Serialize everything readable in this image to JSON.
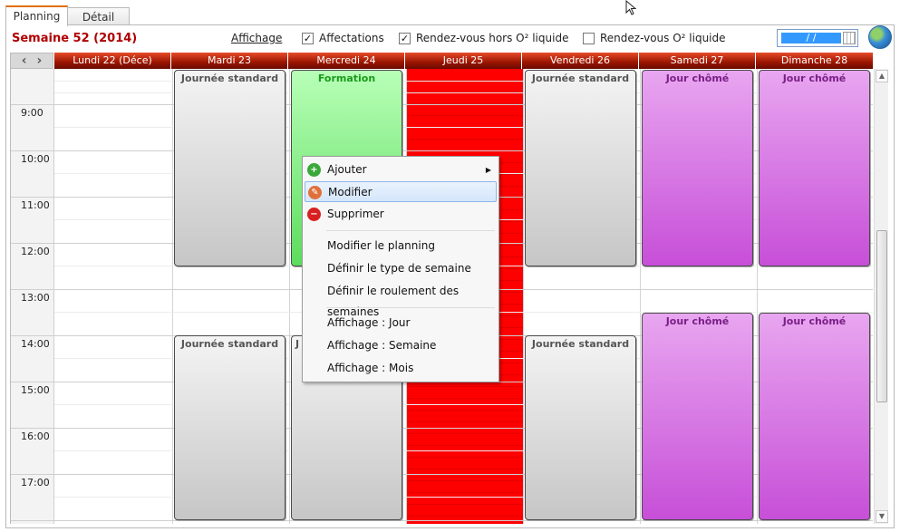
{
  "tabs": [
    {
      "label": "Planning",
      "active": true
    },
    {
      "label": "Détail",
      "active": false
    }
  ],
  "toolbar": {
    "week_title": "Semaine 52 (2014)",
    "affichage_label": "Affichage",
    "filters": [
      {
        "label": "Affectations",
        "checked": true
      },
      {
        "label": "Rendez-vous hors O² liquide",
        "checked": true
      },
      {
        "label": "Rendez-vous O² liquide",
        "checked": false
      }
    ],
    "date_value": "  /  /",
    "globe_icon": "globe-icon"
  },
  "nav": {
    "prev_icon": "chevron-left-icon",
    "next_icon": "chevron-right-icon",
    "prev_glyph": "‹",
    "next_glyph": "›"
  },
  "days": [
    "Lundi 22 (Déce)",
    "Mardi 23",
    "Mercredi 24",
    "Jeudi 25",
    "Vendredi 26",
    "Samedi 27",
    "Dimanche 28"
  ],
  "times": [
    "9:00",
    "10:00",
    "11:00",
    "12:00",
    "13:00",
    "14:00",
    "15:00",
    "16:00",
    "17:00"
  ],
  "events": [
    {
      "day": "Mardi 23",
      "label": "Journée standard",
      "kind": "standard",
      "period": "morning"
    },
    {
      "day": "Mercredi 24",
      "label": "Formation",
      "kind": "formation",
      "period": "morning"
    },
    {
      "day": "Jeudi 25",
      "label": "",
      "kind": "holiday-fill",
      "period": "all-day"
    },
    {
      "day": "Vendredi 26",
      "label": "Journée standard",
      "kind": "standard",
      "period": "morning"
    },
    {
      "day": "Samedi 27",
      "label": "Jour chômé",
      "kind": "chome",
      "period": "morning"
    },
    {
      "day": "Dimanche 28",
      "label": "Jour chômé",
      "kind": "chome",
      "period": "morning"
    },
    {
      "day": "Mardi 23",
      "label": "Journée standard",
      "kind": "standard",
      "period": "afternoon"
    },
    {
      "day": "Mercredi 24",
      "label": "J",
      "kind": "standard",
      "period": "afternoon"
    },
    {
      "day": "Vendredi 26",
      "label": "Journée standard",
      "kind": "standard",
      "period": "afternoon"
    },
    {
      "day": "Samedi 27",
      "label": "Jour chômé",
      "kind": "chome",
      "period": "afternoon"
    },
    {
      "day": "Dimanche 28",
      "label": "Jour chômé",
      "kind": "chome",
      "period": "afternoon"
    }
  ],
  "context_menu": {
    "items": [
      {
        "label": "Ajouter",
        "icon": "add-icon",
        "submenu": true,
        "highlighted": false
      },
      {
        "label": "Modifier",
        "icon": "edit-icon",
        "submenu": false,
        "highlighted": true
      },
      {
        "label": "Supprimer",
        "icon": "delete-icon",
        "submenu": false,
        "highlighted": false
      },
      {
        "label": "Modifier le planning",
        "icon": "",
        "submenu": false,
        "highlighted": false
      },
      {
        "label": "Définir le type de semaine",
        "icon": "",
        "submenu": false,
        "highlighted": false
      },
      {
        "label": "Définir le roulement des semaines",
        "icon": "",
        "submenu": false,
        "highlighted": false
      },
      {
        "label": "Affichage : Jour",
        "icon": "",
        "submenu": false,
        "highlighted": false
      },
      {
        "label": "Affichage : Semaine",
        "icon": "",
        "submenu": false,
        "highlighted": false
      },
      {
        "label": "Affichage : Mois",
        "icon": "",
        "submenu": false,
        "highlighted": false
      }
    ],
    "submenu_glyph": "▶"
  },
  "colors": {
    "header_red": "#9a1500",
    "holiday_red": "#ff0000",
    "chome": "#c74fd8",
    "formation": "#5ddc5d",
    "week_title": "#b00000",
    "menu_highlight": "#d4e6fb"
  }
}
